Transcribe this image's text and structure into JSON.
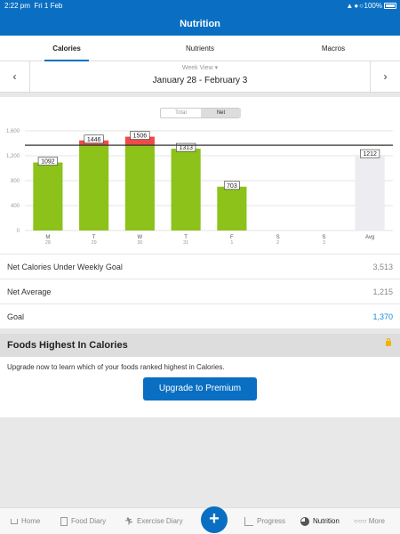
{
  "status": {
    "time": "2:22 pm",
    "date": "Fri 1 Feb",
    "battery": "100%"
  },
  "header": {
    "title": "Nutrition"
  },
  "tabs": [
    {
      "label": "Calories",
      "active": true
    },
    {
      "label": "Nutrients",
      "active": false
    },
    {
      "label": "Macros",
      "active": false
    }
  ],
  "week": {
    "view": "Week View",
    "range": "January 28 - February 3"
  },
  "toggle": {
    "total": "Total",
    "net": "Net"
  },
  "chart_data": {
    "type": "bar",
    "categories": [
      {
        "day": "M",
        "date": "28"
      },
      {
        "day": "T",
        "date": "29"
      },
      {
        "day": "W",
        "date": "30"
      },
      {
        "day": "T",
        "date": "31"
      },
      {
        "day": "F",
        "date": "1"
      },
      {
        "day": "S",
        "date": "2"
      },
      {
        "day": "S",
        "date": "3"
      },
      {
        "day": "Avg",
        "date": ""
      }
    ],
    "values": [
      1092,
      1446,
      1506,
      1313,
      703,
      null,
      null,
      1212
    ],
    "goal": 1370,
    "ylim": [
      0,
      1600
    ],
    "yticks": [
      "0",
      "400",
      "800",
      "1,200",
      "1,600"
    ],
    "ytick_values": [
      0,
      400,
      800,
      1200,
      1600
    ],
    "colors": {
      "under": "#8cc21a",
      "over": "#ef4a4a",
      "avg": "#ececf1",
      "goal_line": "#333333"
    }
  },
  "stats": {
    "under_label": "Net Calories Under Weekly Goal",
    "under_value": "3,513",
    "avg_label": "Net Average",
    "avg_value": "1,215",
    "goal_label": "Goal",
    "goal_value": "1,370"
  },
  "foods": {
    "title": "Foods Highest In Calories",
    "message": "Upgrade now to learn which of your foods ranked highest in Calories.",
    "button": "Upgrade to Premium"
  },
  "bottom_nav": {
    "home": "Home",
    "food_diary": "Food Diary",
    "exercise_diary": "Exercise Diary",
    "add": "+",
    "progress": "Progress",
    "nutrition": "Nutrition",
    "more": "More"
  }
}
